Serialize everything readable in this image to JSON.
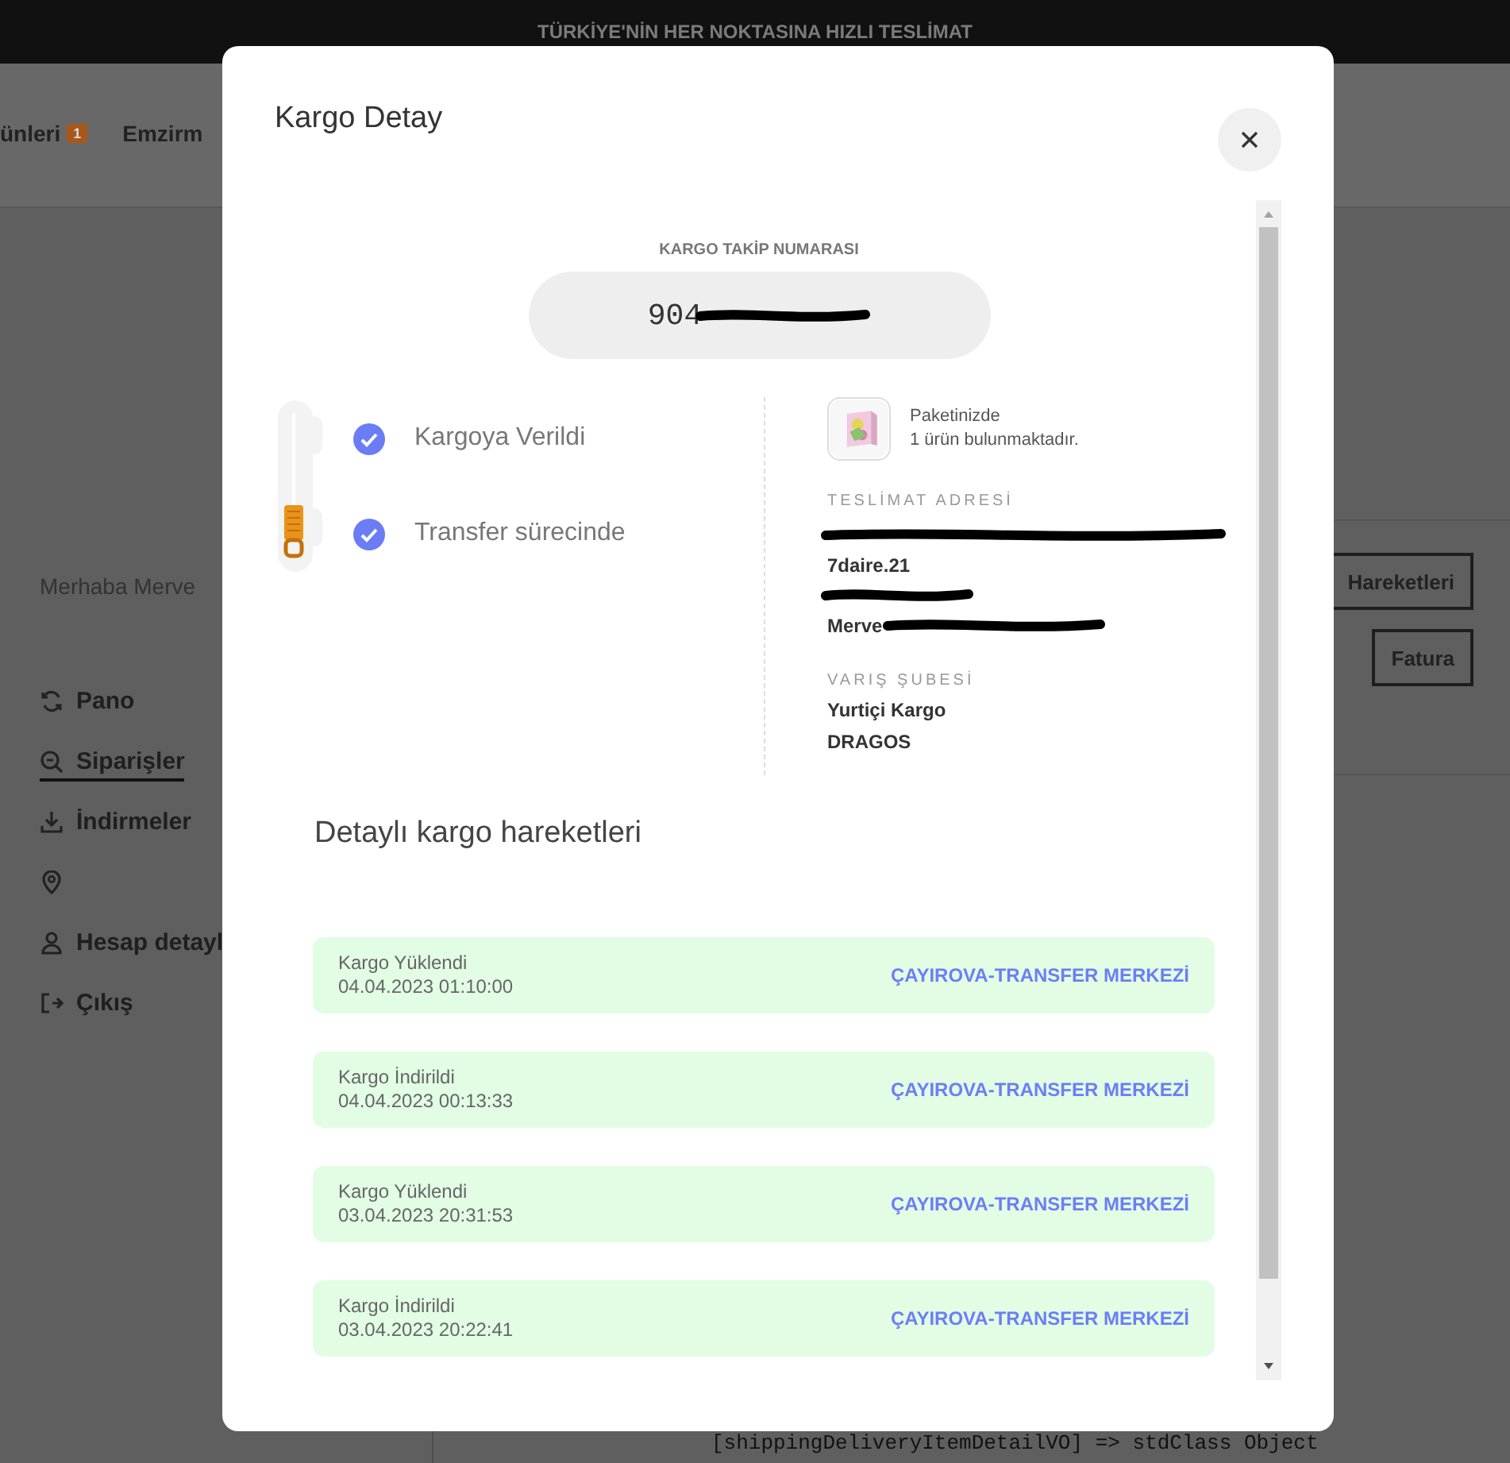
{
  "top_bar": {
    "text": "TÜRKİYE'NİN HER NOKTASINA HIZLI TESLİMAT"
  },
  "nav": [
    {
      "label": "ünleri",
      "badge": "1"
    },
    {
      "label": "Emzirm"
    }
  ],
  "sidebar": {
    "greeting": "Merhaba Merve",
    "items": [
      {
        "label": "Pano",
        "selected": false
      },
      {
        "label": "Siparişler",
        "selected": true
      },
      {
        "label": "İndirmeler",
        "selected": false
      },
      {
        "selected": false
      },
      {
        "label": "Hesap detayl",
        "selected": false
      },
      {
        "label": "Çıkış",
        "selected": false
      }
    ]
  },
  "order_buttons": [
    "Hareketleri",
    "Fatura"
  ],
  "debug_output": "[shippingDeliveryItemDetailVO] => stdClass Object",
  "modal": {
    "title": "Kargo Detay",
    "tracking": {
      "label": "KARGO TAKİP NUMARASI",
      "number": "904",
      "redacted": true
    },
    "steps": [
      {
        "label": "Kargoya Verildi",
        "checked": true
      },
      {
        "label": "Transfer sürecinde",
        "checked": true
      }
    ],
    "package": {
      "title": "Paketinizde",
      "subtitle": "1 ürün bulunmaktadır."
    },
    "address": {
      "label": "TESLİMAT ADRESİ",
      "lines": [
        {
          "redacted": true
        },
        {
          "text": "7daire.21",
          "redacted": false
        },
        {
          "redacted": true
        },
        {
          "text": "Merve",
          "redacted": true
        }
      ]
    },
    "branch": {
      "label": "VARIŞ ŞUBESİ",
      "lines": [
        "Yurtiçi Kargo",
        "DRAGOS"
      ]
    },
    "movements": {
      "title": "Detaylı kargo hareketleri",
      "items": [
        {
          "status": "Kargo Yüklendi",
          "time": "04.04.2023 01:10:00",
          "location": "ÇAYIROVA-TRANSFER MERKEZİ"
        },
        {
          "status": "Kargo İndirildi",
          "time": "04.04.2023 00:13:33",
          "location": "ÇAYIROVA-TRANSFER MERKEZİ"
        },
        {
          "status": "Kargo Yüklendi",
          "time": "03.04.2023 20:31:53",
          "location": "ÇAYIROVA-TRANSFER MERKEZİ"
        },
        {
          "status": "Kargo İndirildi",
          "time": "03.04.2023 20:22:41",
          "location": "ÇAYIROVA-TRANSFER MERKEZİ"
        }
      ]
    }
  }
}
